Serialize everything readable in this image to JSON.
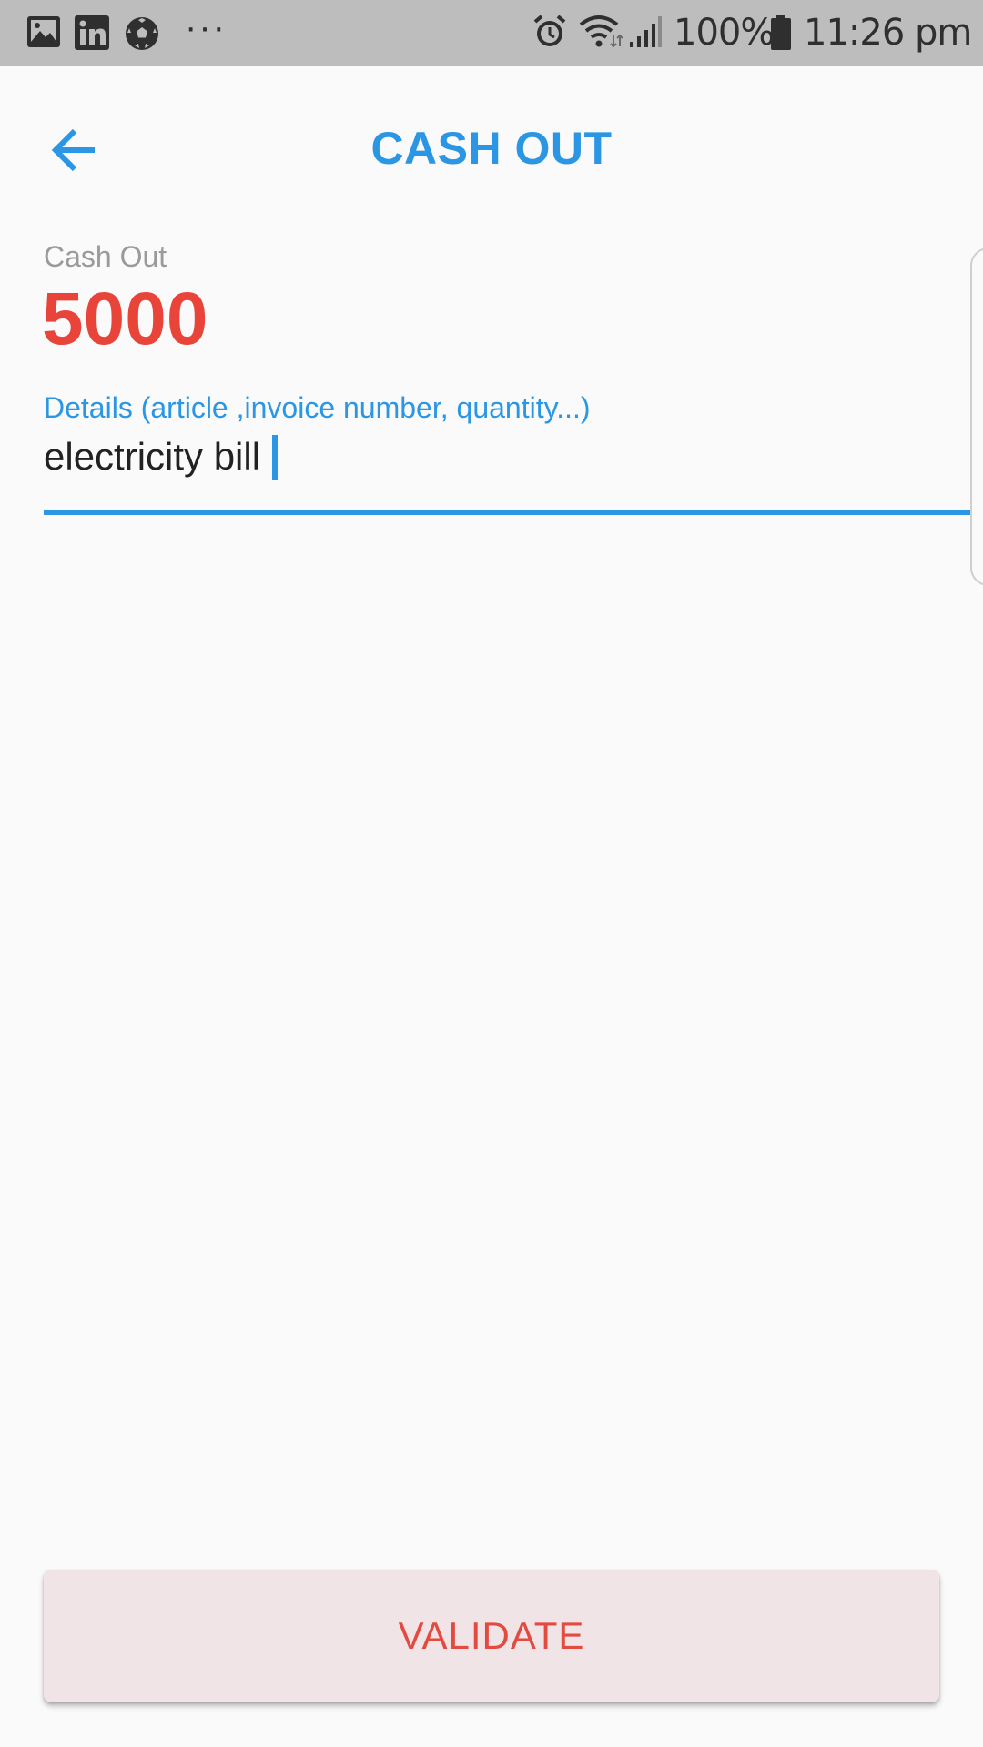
{
  "status_bar": {
    "notification_icons": [
      "gallery-icon",
      "linkedin-icon",
      "soccer-ball-icon"
    ],
    "more_indicator": "···",
    "system_icons": [
      "alarm-icon",
      "wifi-icon",
      "signal-icon",
      "battery-icon"
    ],
    "battery_percent": "100%",
    "time": "11:26 pm"
  },
  "app_bar": {
    "back_icon": "arrow-left-icon",
    "title": "CASH OUT"
  },
  "amount": {
    "label": "Cash Out",
    "value": "5000"
  },
  "details": {
    "label": "Details (article ,invoice number, quantity...)",
    "value": "electricity bill"
  },
  "actions": {
    "validate_label": "VALIDATE"
  },
  "colors": {
    "accent": "#2b96e4",
    "amount": "#e8443a",
    "button_background": "#f1e4e6",
    "button_text": "#e34a40",
    "status_bar": "#bdbdbd",
    "background": "#fafafa"
  }
}
